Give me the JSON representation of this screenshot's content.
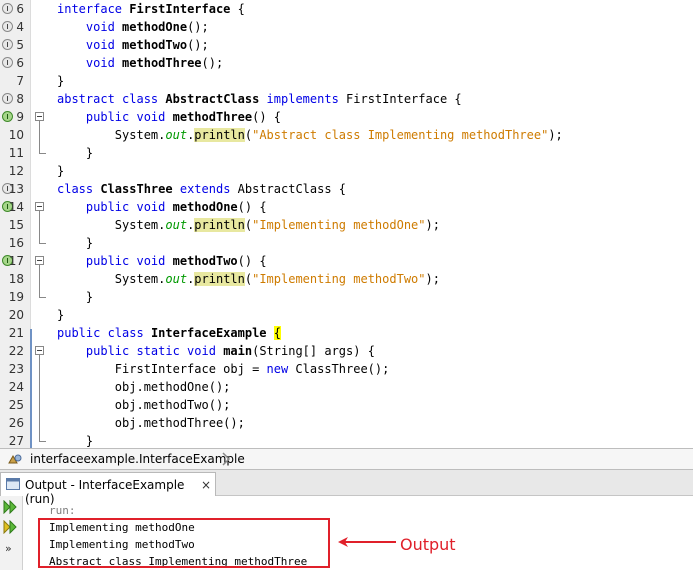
{
  "editor": {
    "lines": [
      {
        "n": "6",
        "glyph": "info",
        "fold": "",
        "html": "<span class=\"kw\">interface</span> <span class=\"b\">FirstInterface</span> {"
      },
      {
        "n": "4",
        "glyph": "info",
        "fold": "",
        "html": "    <span class=\"kw\">void</span> <span class=\"b\">methodOne</span>();"
      },
      {
        "n": "5",
        "glyph": "info",
        "fold": "",
        "html": "    <span class=\"kw\">void</span> <span class=\"b\">methodTwo</span>();"
      },
      {
        "n": "6",
        "glyph": "info",
        "fold": "",
        "html": "    <span class=\"kw\">void</span> <span class=\"b\">methodThree</span>();"
      },
      {
        "n": "7",
        "glyph": "",
        "fold": "",
        "html": "}"
      },
      {
        "n": "8",
        "glyph": "info",
        "fold": "",
        "html": "<span class=\"kw\">abstract class</span> <span class=\"b\">AbstractClass</span> <span class=\"kw\">implements</span> FirstInterface {"
      },
      {
        "n": "9",
        "glyph": "impl",
        "fold": "start",
        "html": "    <span class=\"kw\">public void</span> <span class=\"b\">methodThree</span>() {"
      },
      {
        "n": "10",
        "glyph": "",
        "fold": "",
        "html": "        System.<span class=\"it\">out</span>.<span class=\"hl\">println</span>(<span class=\"str\">\"Abstract class Implementing methodThree\"</span>);"
      },
      {
        "n": "11",
        "glyph": "",
        "fold": "end",
        "html": "    }"
      },
      {
        "n": "12",
        "glyph": "",
        "fold": "",
        "html": "}"
      },
      {
        "n": "13",
        "glyph": "info",
        "fold": "",
        "html": "<span class=\"kw\">class</span> <span class=\"b\">ClassThree</span> <span class=\"kw\">extends</span> AbstractClass {"
      },
      {
        "n": "14",
        "glyph": "impl",
        "fold": "start",
        "html": "    <span class=\"kw\">public void</span> <span class=\"b\">methodOne</span>() {"
      },
      {
        "n": "15",
        "glyph": "",
        "fold": "",
        "html": "        System.<span class=\"it\">out</span>.<span class=\"hl\">println</span>(<span class=\"str\">\"Implementing methodOne\"</span>);"
      },
      {
        "n": "16",
        "glyph": "",
        "fold": "end",
        "html": "    }"
      },
      {
        "n": "17",
        "glyph": "impl",
        "fold": "start",
        "html": "    <span class=\"kw\">public void</span> <span class=\"b\">methodTwo</span>() {"
      },
      {
        "n": "18",
        "glyph": "",
        "fold": "",
        "html": "        System.<span class=\"it\">out</span>.<span class=\"hl\">println</span>(<span class=\"str\">\"Implementing methodTwo\"</span>);"
      },
      {
        "n": "19",
        "glyph": "",
        "fold": "end",
        "html": "    }"
      },
      {
        "n": "20",
        "glyph": "",
        "fold": "",
        "html": "}"
      },
      {
        "n": "21",
        "glyph": "",
        "fold": "",
        "html": "<span class=\"kw\">public class</span> <span class=\"b\">InterfaceExample</span> <span class=\"hly\">{</span>"
      },
      {
        "n": "22",
        "glyph": "",
        "fold": "start",
        "html": "    <span class=\"kw\">public static void</span> <span class=\"b\">main</span>(String[] args) {"
      },
      {
        "n": "23",
        "glyph": "",
        "fold": "",
        "html": "        FirstInterface obj = <span class=\"kw\">new</span> ClassThree();"
      },
      {
        "n": "24",
        "glyph": "",
        "fold": "",
        "html": "        obj.methodOne();"
      },
      {
        "n": "25",
        "glyph": "",
        "fold": "",
        "html": "        obj.methodTwo();"
      },
      {
        "n": "26",
        "glyph": "",
        "fold": "",
        "html": "        obj.methodThree();"
      },
      {
        "n": "27",
        "glyph": "",
        "fold": "end",
        "html": "    }"
      }
    ]
  },
  "breadcrumb": {
    "path": "interfaceexample.InterfaceExample"
  },
  "output": {
    "tab_label": "Output - InterfaceExample (run)",
    "close": "×",
    "more": "»",
    "run_label": "run:",
    "lines": [
      "Implementing methodOne",
      "Implementing methodTwo",
      "Abstract class Implementing methodThree"
    ]
  },
  "annotation": {
    "text": "Output",
    "color": "#e0202a"
  },
  "colors": {
    "keyword": "#0000e6",
    "string": "#ce7b00",
    "field": "#009900",
    "highlight": "#e8e8a0"
  }
}
